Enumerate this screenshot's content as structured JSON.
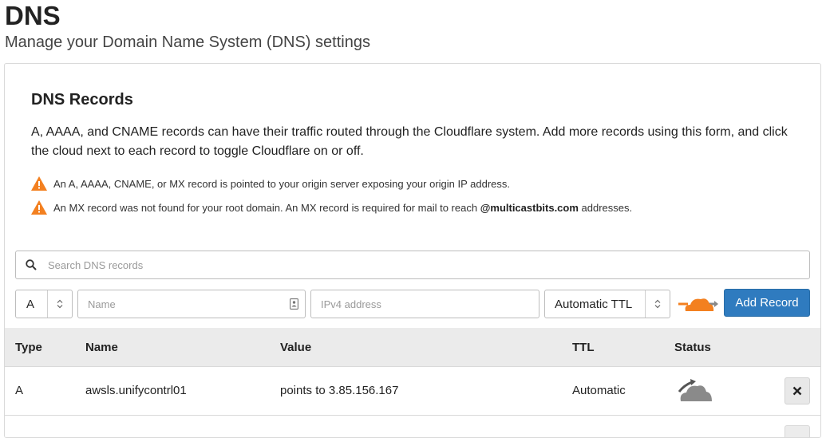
{
  "header": {
    "title": "DNS",
    "subtitle": "Manage your Domain Name System (DNS) settings"
  },
  "card": {
    "title": "DNS Records",
    "description": "A, AAAA, and CNAME records can have their traffic routed through the Cloudflare system. Add more records using this form, and click the cloud next to each record to toggle Cloudflare on or off.",
    "warnings": [
      {
        "icon": "warning-triangle-icon",
        "text": "An A, AAAA, CNAME, or MX record is pointed to your origin server exposing your origin IP address."
      },
      {
        "icon": "warning-triangle-icon",
        "text_before": "An MX record was not found for your root domain. An MX record is required for mail to reach ",
        "domain": "@multicastbits.com",
        "text_after": " addresses."
      }
    ],
    "warning_color": "#f38020"
  },
  "search": {
    "placeholder": "Search DNS records",
    "icon": "search-icon"
  },
  "add_form": {
    "type_value": "A",
    "name_placeholder": "Name",
    "value_placeholder": "IPv4 address",
    "ttl_value": "Automatic TTL",
    "proxy_icon": "orange-cloud-icon",
    "add_button_label": "Add Record",
    "button_color": "#2f7bbf"
  },
  "table": {
    "headers": {
      "type": "Type",
      "name": "Name",
      "value": "Value",
      "ttl": "TTL",
      "status": "Status"
    },
    "rows": [
      {
        "type": "A",
        "name": "awsls.unifycontrl01",
        "value": "points to 3.85.156.167",
        "ttl": "Automatic",
        "status_icon": "grey-cloud-icon",
        "delete_icon": "close-icon"
      }
    ]
  }
}
